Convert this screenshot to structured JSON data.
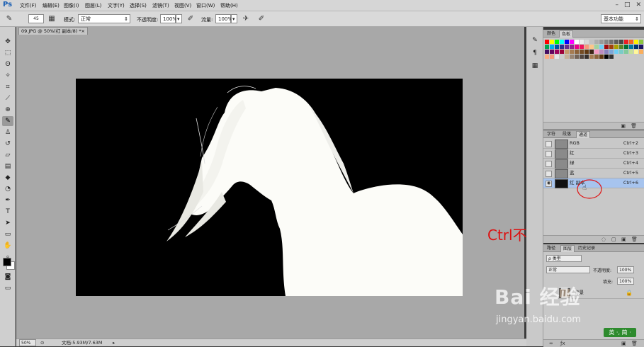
{
  "app": {
    "logo": "Ps",
    "menus": [
      "文件(F)",
      "编辑(E)",
      "图像(I)",
      "图层(L)",
      "文字(Y)",
      "选择(S)",
      "滤镜(T)",
      "视图(V)",
      "窗口(W)",
      "帮助(H)"
    ],
    "window_controls": [
      "–",
      "□",
      "✕"
    ]
  },
  "options": {
    "brush_size": "45",
    "mode_label": "模式:",
    "mode_value": "正常",
    "opacity_label": "不透明度:",
    "opacity_value": "100%",
    "flow_label": "流量:",
    "flow_value": "100%",
    "workspace": "基本功能"
  },
  "document": {
    "tab_title": "09.JPG @ 50%(红 副本/8) *",
    "tab_close": "×",
    "annotation": "Ctrl不放",
    "zoom": "50%",
    "file_info": "文档:5.93M/7.63M"
  },
  "swatch_panel": {
    "tabs": [
      "颜色",
      "色板"
    ],
    "active_tab": "色板",
    "colors": [
      "#ff0000",
      "#ffff00",
      "#00ff00",
      "#00ffff",
      "#0000ff",
      "#ff00ff",
      "#ffffff",
      "#ebebeb",
      "#d6d6d6",
      "#c2c2c2",
      "#adadad",
      "#999999",
      "#858585",
      "#707070",
      "#5c5c5c",
      "#474747",
      "#ed1c24",
      "#f26522",
      "#fff200",
      "#8dc63f",
      "#00a651",
      "#00aeef",
      "#0054a6",
      "#2e3192",
      "#662d91",
      "#92278f",
      "#ec008c",
      "#ed145b",
      "#f7977a",
      "#fdc689",
      "#a3d39c",
      "#6dcff6",
      "#9e0b0f",
      "#a0410d",
      "#aba000",
      "#598527",
      "#007236",
      "#0076a3",
      "#003471",
      "#1b1464",
      "#440e62",
      "#630460",
      "#9e005d",
      "#9e0039",
      "#c69c6d",
      "#a67c52",
      "#8c6239",
      "#754c24",
      "#603913",
      "#3c2415",
      "#f49ac1",
      "#bd8cbf",
      "#8882be",
      "#7da7d9",
      "#6ecff6",
      "#7accc8",
      "#82ca9c",
      "#c4df9b",
      "#fff799",
      "#fbaf5d",
      "#f9ad81",
      "#f7977a",
      "#e6e6e6",
      "#cccccc",
      "#c7b299",
      "#998675",
      "#736357",
      "#534741",
      "#362f2d",
      "#a67c52",
      "#8c6239",
      "#603913",
      "#000000",
      "#333333"
    ]
  },
  "channels_panel": {
    "tabs": [
      "字符",
      "段落",
      "通道"
    ],
    "active_tab": "通道",
    "rows": [
      {
        "name": "RGB",
        "shortcut": "Ctrl+2",
        "visible": false,
        "selected": false
      },
      {
        "name": "红",
        "shortcut": "Ctrl+3",
        "visible": false,
        "selected": false
      },
      {
        "name": "绿",
        "shortcut": "Ctrl+4",
        "visible": false,
        "selected": false
      },
      {
        "name": "蓝",
        "shortcut": "Ctrl+5",
        "visible": false,
        "selected": false
      },
      {
        "name": "红 副本",
        "shortcut": "Ctrl+6",
        "visible": true,
        "selected": true
      }
    ]
  },
  "layers_panel": {
    "tabs": [
      "路径",
      "图层",
      "历史记录"
    ],
    "active_tab": "图层",
    "filter": "ρ 类型",
    "blend_mode": "正常",
    "opacity_label": "不透明度:",
    "opacity_value": "100%",
    "fill_label": "填充:",
    "fill_value": "100%",
    "layer_name": "背景"
  },
  "watermark": {
    "logo": "Bai 经验",
    "url": "jingyan.baidu.com"
  },
  "ime_badge": "英 ·, 简 ·"
}
